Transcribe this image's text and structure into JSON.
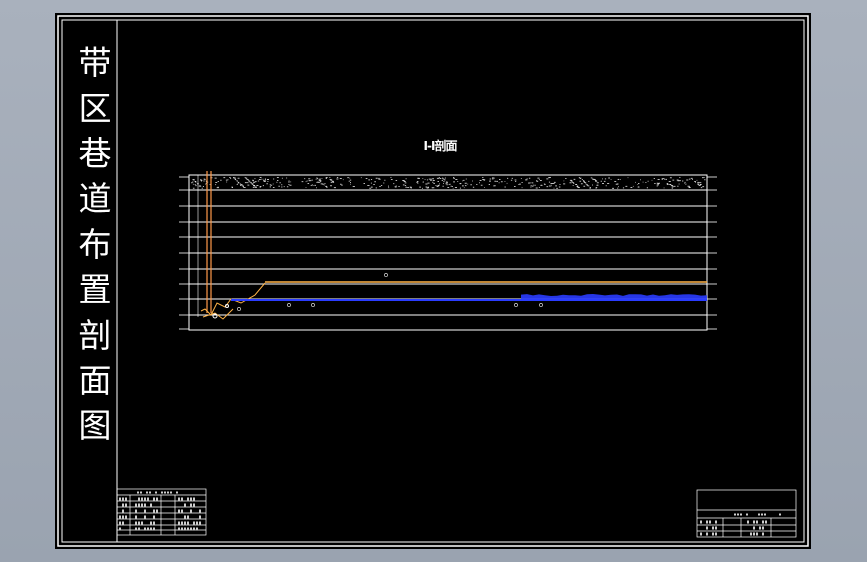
{
  "window": {
    "background": "#9ea6b2"
  },
  "drawing_sheet": {
    "vertical_title": [
      "带",
      "区",
      "巷",
      "道",
      "布",
      "置",
      "剖",
      "面",
      "图"
    ],
    "section_title": "I-I剖面",
    "colors": {
      "paper": "#000000",
      "frame": "#ffffff",
      "roadway": "#ffb347",
      "seam": "#2a3cff",
      "shaft": "#ff9a4a"
    }
  }
}
